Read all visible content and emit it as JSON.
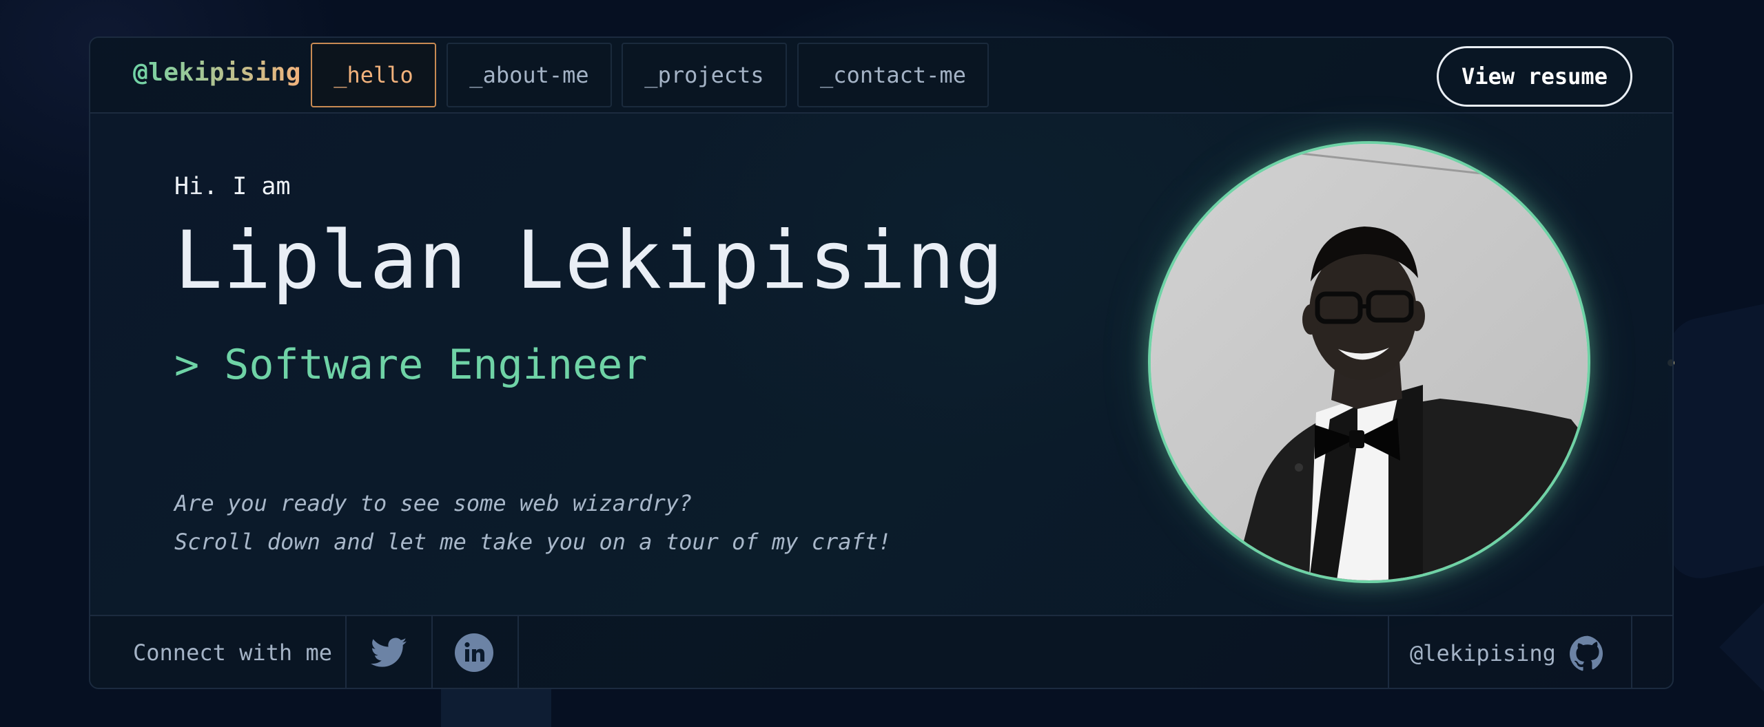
{
  "nav": {
    "logo": "@lekipising",
    "tabs": [
      {
        "label": "_hello",
        "active": true
      },
      {
        "label": "_about-me",
        "active": false
      },
      {
        "label": "_projects",
        "active": false
      },
      {
        "label": "_contact-me",
        "active": false
      }
    ],
    "resume_button": "View resume"
  },
  "hero": {
    "greeting": "Hi. I am",
    "name": "Liplan Lekipising",
    "role": "> Software Engineer",
    "tagline_line1": "Are you ready to see some web wizardry?",
    "tagline_line2": "Scroll down and let me take you on a tour of my craft!"
  },
  "footer": {
    "connect_label": "Connect with me",
    "socials": [
      {
        "icon": "twitter-icon"
      },
      {
        "icon": "linkedin-icon"
      }
    ],
    "github_handle": "@lekipising",
    "github_icon": "github-icon"
  },
  "colors": {
    "background": "#061022",
    "accent_green": "#6fd3a6",
    "accent_orange": "#f2b27c",
    "muted_text": "#a4b3c6",
    "icon_gray": "#6c83a5"
  }
}
